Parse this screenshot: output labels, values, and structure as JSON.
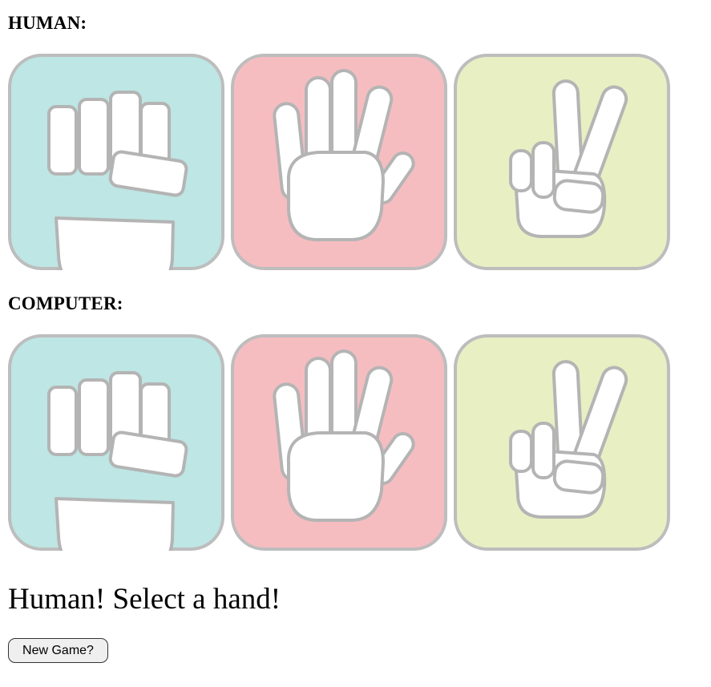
{
  "human": {
    "label": "HUMAN:",
    "hands": [
      {
        "name": "rock",
        "icon": "fist-icon",
        "color": "#bde6e4"
      },
      {
        "name": "paper",
        "icon": "open-hand-icon",
        "color": "#f6bdc1"
      },
      {
        "name": "scissors",
        "icon": "peace-sign-icon",
        "color": "#e8efc3"
      }
    ]
  },
  "computer": {
    "label": "COMPUTER:",
    "hands": [
      {
        "name": "rock",
        "icon": "fist-icon",
        "color": "#bde6e4"
      },
      {
        "name": "paper",
        "icon": "open-hand-icon",
        "color": "#f6bdc1"
      },
      {
        "name": "scissors",
        "icon": "peace-sign-icon",
        "color": "#e8efc3"
      }
    ]
  },
  "status": {
    "message": "Human! Select a hand!"
  },
  "controls": {
    "new_game_label": "New Game?"
  },
  "colors": {
    "card_border": "#bdbdbd",
    "hand_fill": "#ffffff",
    "hand_outline": "#b4b4b4"
  }
}
